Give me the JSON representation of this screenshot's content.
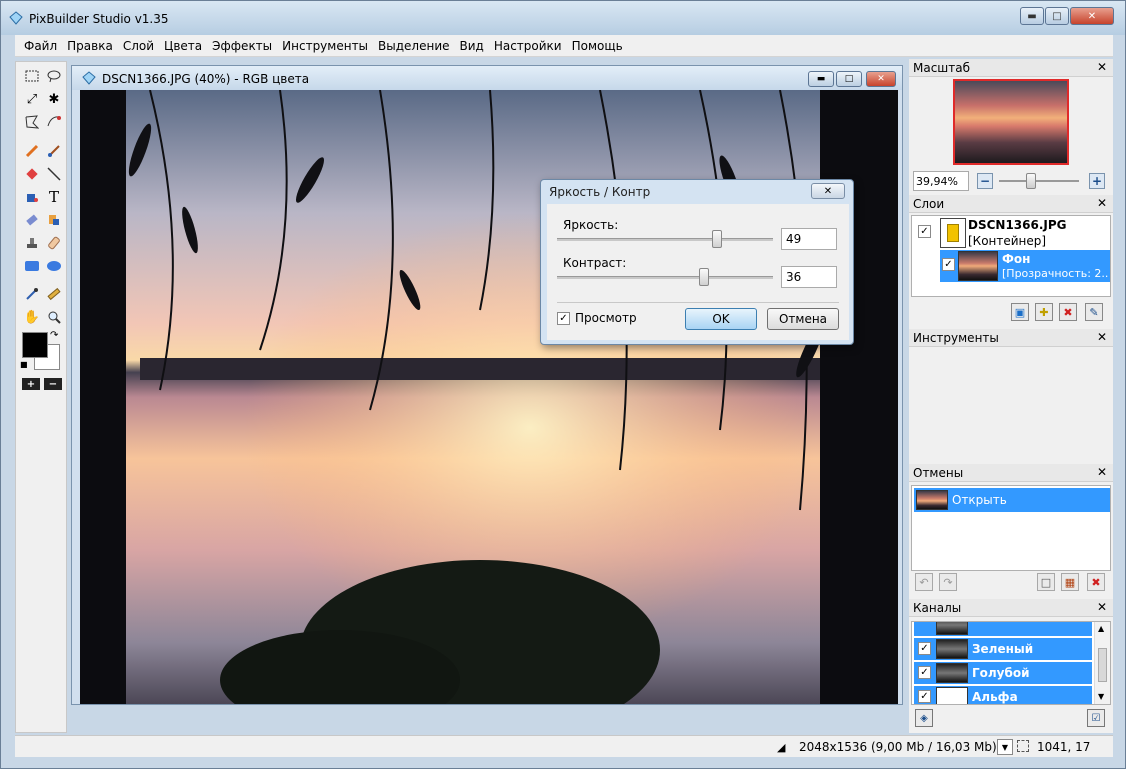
{
  "app": {
    "title": "PixBuilder Studio v1.35"
  },
  "menu": [
    "Файл",
    "Правка",
    "Слой",
    "Цвета",
    "Эффекты",
    "Инструменты",
    "Выделение",
    "Вид",
    "Настройки",
    "Помощь"
  ],
  "document": {
    "title": "DSCN1366.JPG (40%) - RGB цвета"
  },
  "dialog": {
    "title": "Яркость / Контр",
    "brightness_label": "Яркость:",
    "brightness_value": "49",
    "brightness_fraction": 0.74,
    "contrast_label": "Контраст:",
    "contrast_value": "36",
    "contrast_fraction": 0.68,
    "preview_label": "Просмотр",
    "preview_checked": true,
    "ok_label": "OK",
    "cancel_label": "Отмена"
  },
  "panels": {
    "scale": {
      "title": "Масштаб",
      "zoom_value": "39,94%",
      "zoom_fraction": 0.4
    },
    "layers": {
      "title": "Слои",
      "items": [
        {
          "name": "DSCN1366.JPG",
          "sub": "[Контейнер]",
          "checked": true
        },
        {
          "name": "Фон",
          "sub": "[Прозрачность: 2...",
          "checked": true
        }
      ]
    },
    "tools": {
      "title": "Инструменты"
    },
    "history": {
      "title": "Отмены",
      "items": [
        {
          "label": "Открыть"
        }
      ]
    },
    "channels": {
      "title": "Каналы",
      "items": [
        {
          "label": "Зеленый",
          "checked": true
        },
        {
          "label": "Голубой",
          "checked": true
        },
        {
          "label": "Альфа",
          "checked": true
        }
      ]
    }
  },
  "status": {
    "dimensions": "2048x1536  (9,00 Mb / 16,03 Mb)",
    "coords": "1041, 17"
  },
  "colors": {
    "foreground": "#000000",
    "background": "#ffffff",
    "selection": "#3399ff",
    "close_button": "#c7432c"
  }
}
